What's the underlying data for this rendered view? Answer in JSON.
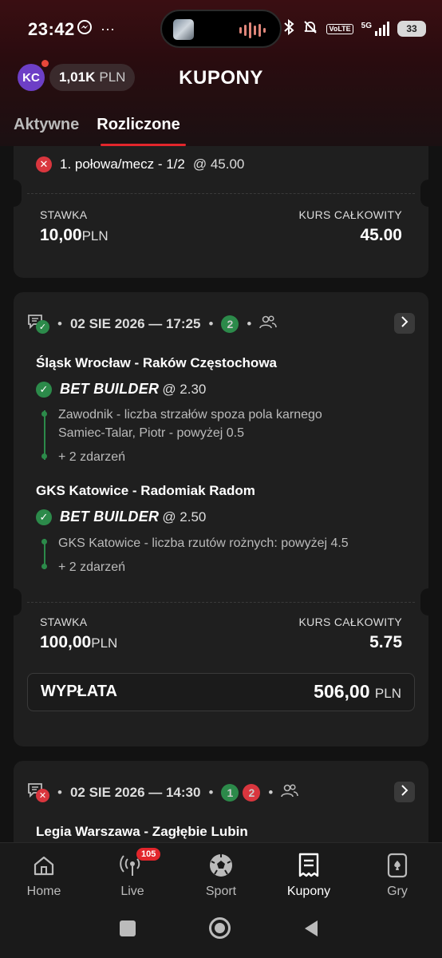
{
  "status_bar": {
    "time": "23:42",
    "battery": "33",
    "volte": "VoLTE",
    "network": "5G"
  },
  "header": {
    "avatar_initials": "KC",
    "balance_value": "1,01K",
    "balance_currency": "PLN",
    "title": "KUPONY"
  },
  "tabs": [
    {
      "label": "Aktywne",
      "active": false
    },
    {
      "label": "Rozliczone",
      "active": true
    }
  ],
  "card1": {
    "selection": "1. połowa/mecz - 1/2",
    "selection_odds": "@ 45.00",
    "stake_label": "STAWKA",
    "stake_value": "10,00",
    "stake_currency": "PLN",
    "total_odds_label": "KURS CAŁKOWITY",
    "total_odds_value": "45.00"
  },
  "card2": {
    "date": "02 SIE 2026 — 17:25",
    "won_count": "2",
    "events": [
      {
        "match": "Śląsk Wrocław - Raków Częstochowa",
        "type": "BET BUILDER",
        "odds": "@ 2.30",
        "detail_line1": "Zawodnik - liczba strzałów spoza pola karnego",
        "detail_line2": "Samiec-Talar, Piotr - powyżej 0.5",
        "more": "+ 2 zdarzeń"
      },
      {
        "match": "GKS Katowice - Radomiak Radom",
        "type": "BET BUILDER",
        "odds": "@ 2.50",
        "detail_line1": "GKS Katowice - liczba rzutów rożnych: powyżej 4.5",
        "more": "+ 2 zdarzeń"
      }
    ],
    "stake_label": "STAWKA",
    "stake_value": "100,00",
    "stake_currency": "PLN",
    "total_odds_label": "KURS CAŁKOWITY",
    "total_odds_value": "5.75",
    "payout_label": "WYPŁATA",
    "payout_value": "506,00",
    "payout_currency": "PLN"
  },
  "card3": {
    "date": "02 SIE 2026 — 14:30",
    "won_count": "1",
    "lost_count": "2",
    "match": "Legia Warszawa - Zagłębie Lubin"
  },
  "bottom_nav": [
    {
      "label": "Home",
      "icon": "home-icon"
    },
    {
      "label": "Live",
      "icon": "live-icon",
      "badge": "105"
    },
    {
      "label": "Sport",
      "icon": "soccer-ball-icon"
    },
    {
      "label": "Kupony",
      "icon": "coupon-icon",
      "active": true
    },
    {
      "label": "Gry",
      "icon": "cards-icon"
    }
  ],
  "colors": {
    "accent": "#e2262c",
    "win": "#2c8a4a",
    "lose": "#d9363e",
    "card_bg": "#1f1f1f"
  }
}
